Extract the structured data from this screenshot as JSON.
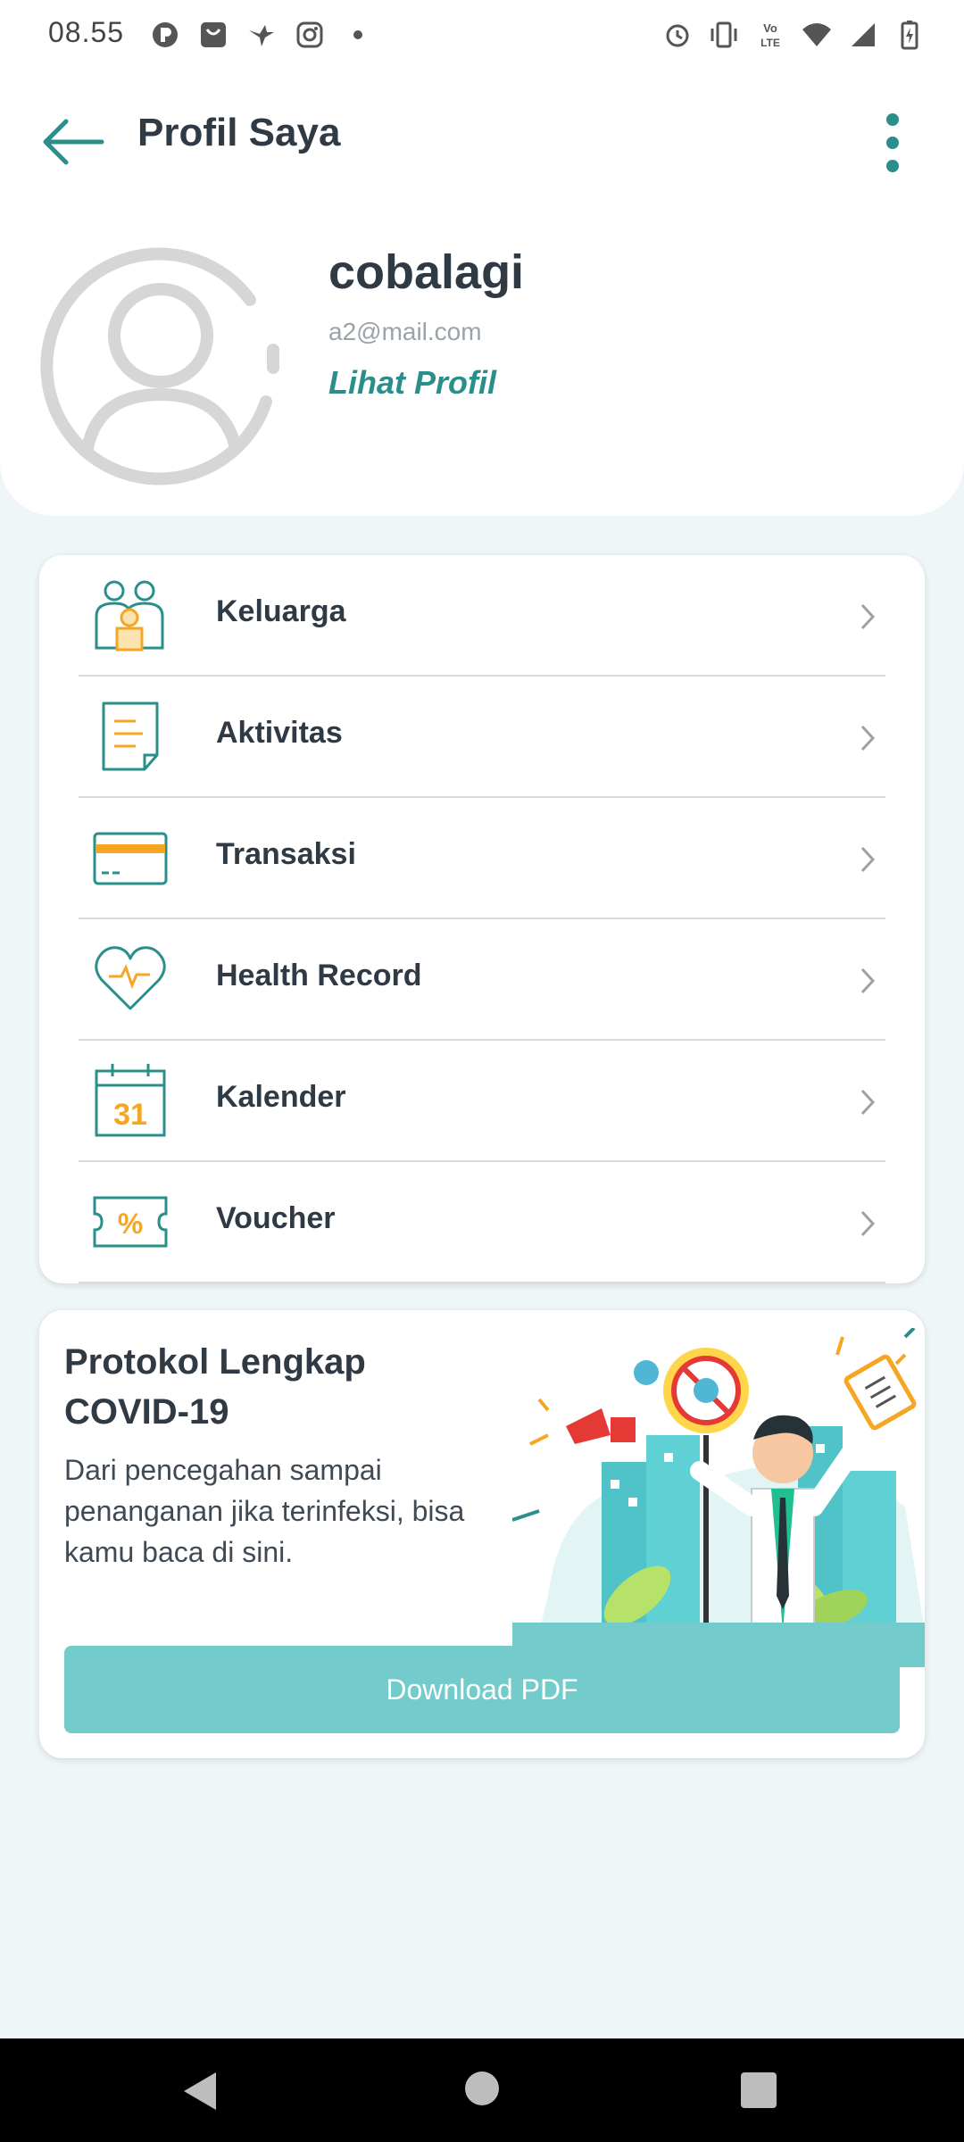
{
  "status_bar": {
    "time": "08.55",
    "left_icons": [
      "app-p-icon",
      "shopping-bag-icon",
      "bird-icon",
      "instagram-icon",
      "dot-icon"
    ],
    "right_icons": [
      "alarm-icon",
      "vibrate-icon",
      "volte-icon",
      "wifi-icon",
      "signal-icon",
      "battery-charging-icon"
    ],
    "volte_text": "Vo LTE"
  },
  "header": {
    "title": "Profil Saya"
  },
  "profile": {
    "name": "cobalagi",
    "email": "a2@mail.com",
    "view_profile_label": "Lihat Profil"
  },
  "menu": {
    "items": [
      {
        "label": "Keluarga",
        "icon": "family-icon"
      },
      {
        "label": "Aktivitas",
        "icon": "activity-document-icon"
      },
      {
        "label": "Transaksi",
        "icon": "credit-card-icon"
      },
      {
        "label": "Health Record",
        "icon": "heart-pulse-icon"
      },
      {
        "label": "Kalender",
        "icon": "calendar-icon",
        "icon_text": "31"
      },
      {
        "label": "Voucher",
        "icon": "voucher-icon",
        "icon_text": "%"
      }
    ]
  },
  "covid_card": {
    "title": "Protokol Lengkap COVID-19",
    "description": "Dari pencegahan sampai penanganan jika terinfeksi, bisa kamu baca di sini.",
    "button_label": "Download PDF"
  },
  "colors": {
    "accent": "#2a8f8a",
    "icon_teal": "#2a8f8a",
    "icon_orange": "#f5a623",
    "button": "#73cbcb",
    "background": "#eef6f7",
    "text_dark": "#2f3a45"
  }
}
